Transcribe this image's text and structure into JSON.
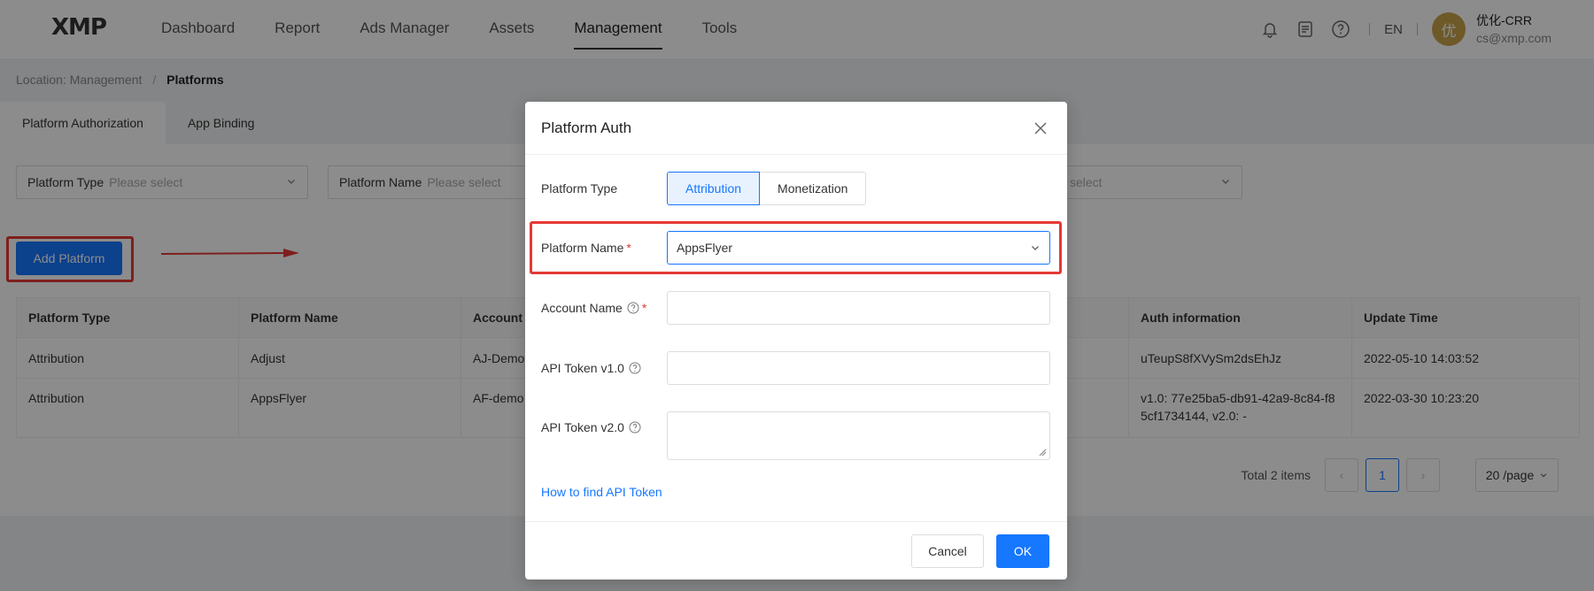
{
  "app": {
    "logo": "XMP"
  },
  "nav": [
    {
      "label": "Dashboard"
    },
    {
      "label": "Report"
    },
    {
      "label": "Ads Manager"
    },
    {
      "label": "Assets"
    },
    {
      "label": "Management"
    },
    {
      "label": "Tools"
    }
  ],
  "nav_active": "Management",
  "header": {
    "icons": [
      "bell-icon",
      "document-icon",
      "help-icon"
    ],
    "language": "EN",
    "avatar_char": "优",
    "user_name": "优化-CRR",
    "user_email": "cs@xmp.com"
  },
  "breadcrumb": {
    "prefix": "Location: Management",
    "separator": "/",
    "current": "Platforms"
  },
  "tabs": [
    {
      "label": "Platform Authorization"
    },
    {
      "label": "App Binding"
    }
  ],
  "filters": {
    "platform_type": {
      "label": "Platform Type",
      "placeholder": "Please select"
    },
    "platform_name": {
      "label": "Platform Name",
      "placeholder": "Please select"
    },
    "third": {
      "placeholder": "select"
    }
  },
  "add_platform_label": "Add Platform",
  "table": {
    "columns": [
      "Platform Type",
      "Platform Name",
      "Account",
      "Auth information",
      "Update Time"
    ],
    "rows": [
      {
        "type": "Attribution",
        "name": "Adjust",
        "account": "AJ-Demo",
        "auth": "uTeupS8fXVySm2dsEhJz",
        "updated": "2022-05-10 14:03:52"
      },
      {
        "type": "Attribution",
        "name": "AppsFlyer",
        "account": "AF-demo",
        "auth_line1": "v1.0: 77e25ba5-db91-42a9-8c84-f8",
        "auth_line2": "5cf1734144, v2.0: -",
        "updated": "2022-03-30 10:23:20"
      }
    ]
  },
  "pagination": {
    "total": "Total 2 items",
    "current": "1",
    "page_size": "20 /page",
    "prev": "‹",
    "next": "›"
  },
  "modal": {
    "title": "Platform Auth",
    "platform_type_label": "Platform Type",
    "platform_type_options": [
      "Attribution",
      "Monetization"
    ],
    "platform_type_selected": "Attribution",
    "platform_name_label": "Platform Name",
    "platform_name_value": "AppsFlyer",
    "account_name_label": "Account Name",
    "api_token_v1_label": "API Token v1.0",
    "api_token_v2_label": "API Token v2.0",
    "help_link": "How to find API Token",
    "cancel_label": "Cancel",
    "ok_label": "OK",
    "required_mark": "*"
  },
  "colors": {
    "primary": "#1677ff",
    "highlight_red": "#e53935",
    "avatar": "#c9a24b"
  }
}
